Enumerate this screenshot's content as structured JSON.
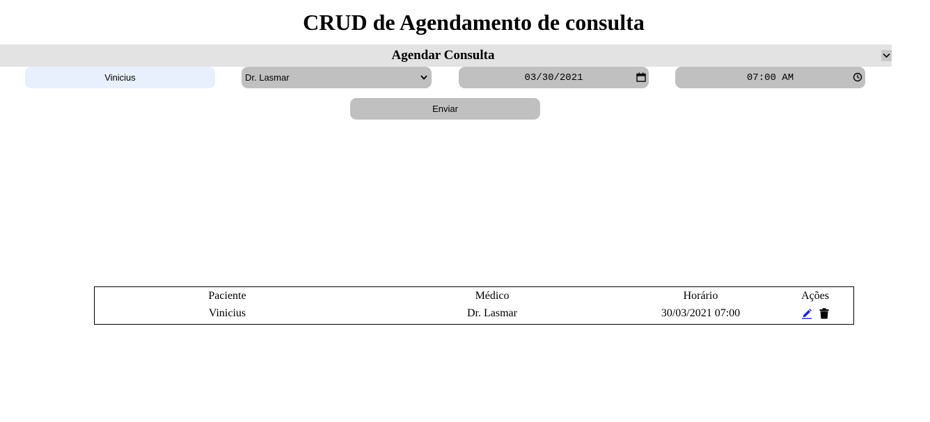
{
  "header": {
    "title": "CRUD de Agendamento de consulta"
  },
  "form": {
    "section_title": "Agendar Consulta",
    "paciente_value": "Vinicius",
    "medico_selected": "Dr. Lasmar",
    "date_value": "03/30/2021",
    "time_value": "07:00 AM",
    "submit_label": "Enviar"
  },
  "table": {
    "headers": [
      "Paciente",
      "Médico",
      "Horário",
      "Ações"
    ],
    "rows": [
      {
        "paciente": "Vinicius",
        "medico": "Dr. Lasmar",
        "horario": "30/03/2021 07:00"
      }
    ]
  },
  "icons": {
    "edit": "pencil-icon",
    "delete": "trash-icon",
    "collapse": "chevron-down-icon",
    "calendar": "calendar-icon",
    "clock": "clock-icon"
  },
  "colors": {
    "section_bar": "#e3e3e3",
    "field_bg": "#c0c0c0",
    "autofill_bg": "#e8f0fe",
    "edit_icon": "#1a1aff"
  }
}
